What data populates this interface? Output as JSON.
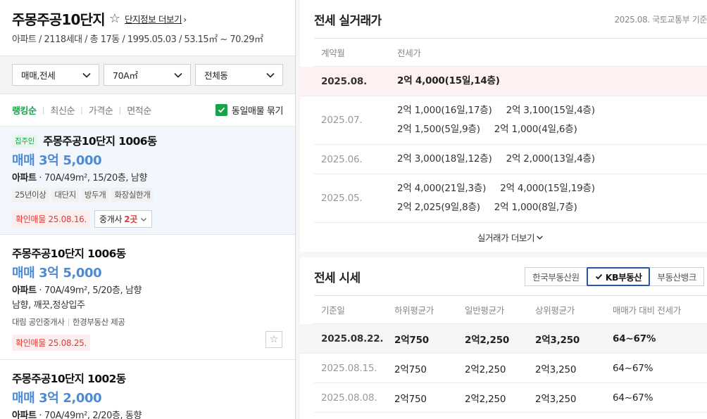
{
  "complex": {
    "title": "주몽주공10단지",
    "star_icon": "star-outline-icon",
    "info_link": "단지정보 더보기",
    "subtitle": "아파트 / 2118세대 / 총 17동 / 1995.05.03 / 53.15㎡ ~ 70.29㎡"
  },
  "filters": [
    {
      "value": "매매,전세"
    },
    {
      "value": "70A㎡"
    },
    {
      "value": "전체동"
    }
  ],
  "sort": {
    "items": [
      "랭킹순",
      "최신순",
      "가격순",
      "면적순"
    ],
    "active": 0,
    "group_toggle": "동일매물 묶기"
  },
  "listings": [
    {
      "badge": "집주인",
      "title": "주몽주공10단지 1006동",
      "price": "매매 3억 5,000",
      "type": "아파트",
      "spec": " · 70A/49m², 15/20층, 남향",
      "tags": [
        "25년이상",
        "대단지",
        "방두개",
        "화장실한개"
      ],
      "confirm": "확인매물 25.08.16.",
      "broker_label": "중개사",
      "broker_count": "2곳"
    },
    {
      "title": "주몽주공10단지 1006동",
      "price": "매매 3억 5,000",
      "type": "아파트",
      "spec": " · 70A/49m², 5/20층, 남향",
      "desc": "남향, 깨끗,정상입주",
      "agency": "대림 공인중개사",
      "provider": "한경부동산 제공",
      "confirm": "확인매물 25.08.25."
    },
    {
      "title": "주몽주공10단지 1002동",
      "price": "매매 3억 2,000",
      "type": "아파트",
      "spec": " · 70A/49m², 2/20층, 동향"
    }
  ],
  "deals": {
    "title": "전세 실거래가",
    "meta": "2025.08. 국토교통부 기준",
    "headers": [
      "계약월",
      "전세가"
    ],
    "rows": [
      {
        "date": "2025.08.",
        "lines": [
          [
            "2억 4,000(15일,14층)"
          ]
        ]
      },
      {
        "date": "2025.07.",
        "lines": [
          [
            "2억 1,000(16일,17층)",
            "2억 3,100(15일,4층)"
          ],
          [
            "2억 1,500(5일,9층)",
            "2억 1,000(4일,6층)"
          ]
        ]
      },
      {
        "date": "2025.06.",
        "lines": [
          [
            "2억 3,000(18일,12층)",
            "2억 2,000(13일,4층)"
          ]
        ]
      },
      {
        "date": "2025.05.",
        "lines": [
          [
            "2억 4,000(21일,3층)",
            "2억 4,000(15일,19층)"
          ],
          [
            "2억 2,025(9일,8층)",
            "2억 1,000(8일,7층)"
          ]
        ]
      }
    ],
    "more": "실거래가 더보기"
  },
  "market": {
    "title": "전세 시세",
    "tabs": [
      "한국부동산원",
      "KB부동산",
      "부동산뱅크"
    ],
    "active_tab": 1,
    "headers": [
      "기준일",
      "하위평균가",
      "일반평균가",
      "상위평균가",
      "매매가 대비 전세가"
    ],
    "rows": [
      {
        "date": "2025.08.22.",
        "low": "2억750",
        "mid": "2억2,250",
        "high": "2억3,250",
        "rate": "64~67%"
      },
      {
        "date": "2025.08.15.",
        "low": "2억750",
        "mid": "2억2,250",
        "high": "2억3,250",
        "rate": "64~67%"
      },
      {
        "date": "2025.08.08.",
        "low": "2억750",
        "mid": "2억2,250",
        "high": "2억3,250",
        "rate": "64~67%"
      }
    ]
  },
  "colors": {
    "accent_green": "#16a34a",
    "price_blue": "#4c8bd4",
    "confirm_red": "#e03a3a",
    "tab_active_border": "#2557a7"
  }
}
